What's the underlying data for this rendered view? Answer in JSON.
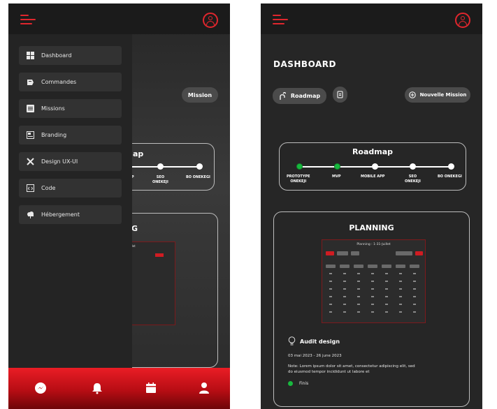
{
  "menu": {
    "items": [
      {
        "label": "Dashboard",
        "icon": "dashboard-icon"
      },
      {
        "label": "Commandes",
        "icon": "commandes-icon"
      },
      {
        "label": "Missions",
        "icon": "missions-icon"
      },
      {
        "label": "Branding",
        "icon": "branding-icon"
      },
      {
        "label": "Design UX-UI",
        "icon": "design-icon"
      },
      {
        "label": "Code",
        "icon": "code-icon"
      },
      {
        "label": "Hébergement",
        "icon": "cloud-icon"
      }
    ]
  },
  "left_screen": {
    "mission_label": "Mission",
    "roadmap_title_partial": "ap",
    "planning_title_partial": "G",
    "calendar_title_partial": "-Juillet",
    "roadmap_labels": [
      "P",
      "SEO\nONEKEJI",
      "BO ONEKEGI"
    ]
  },
  "dashboard": {
    "title": "DASHBOARD",
    "roadmap_button": "Roadmap",
    "new_mission_button": "Nouvelle Mission",
    "roadmap_card_title": "Roadmap",
    "steps": [
      {
        "label": "PROTOTYPE\nONEKEJI",
        "done": true
      },
      {
        "label": "MVP",
        "done": true
      },
      {
        "label": "MOBILE APP",
        "done": false
      },
      {
        "label": "SEO\nONEKEJI",
        "done": false
      },
      {
        "label": "BO ONEKEGI",
        "done": false
      }
    ],
    "planning_title": "PLANNING",
    "calendar_title": "Planning : 1-31-Juillet",
    "audit_title": "Audit design",
    "audit_dates": "03 mai 2023 - 26 june 2023",
    "audit_note": "Note: Lorem ipsum dolor sit amet, consectetur adipiscing elit, sed\ndo eiusmod tempor incididunt ut labore et",
    "status_label": "Finis",
    "status_color": "#18b83e"
  },
  "bottom_nav": {
    "icons": [
      "messenger-icon",
      "bell-icon",
      "calendar-icon",
      "user-icon"
    ]
  },
  "colors": {
    "accent": "#e0262d",
    "background": "#262626"
  }
}
